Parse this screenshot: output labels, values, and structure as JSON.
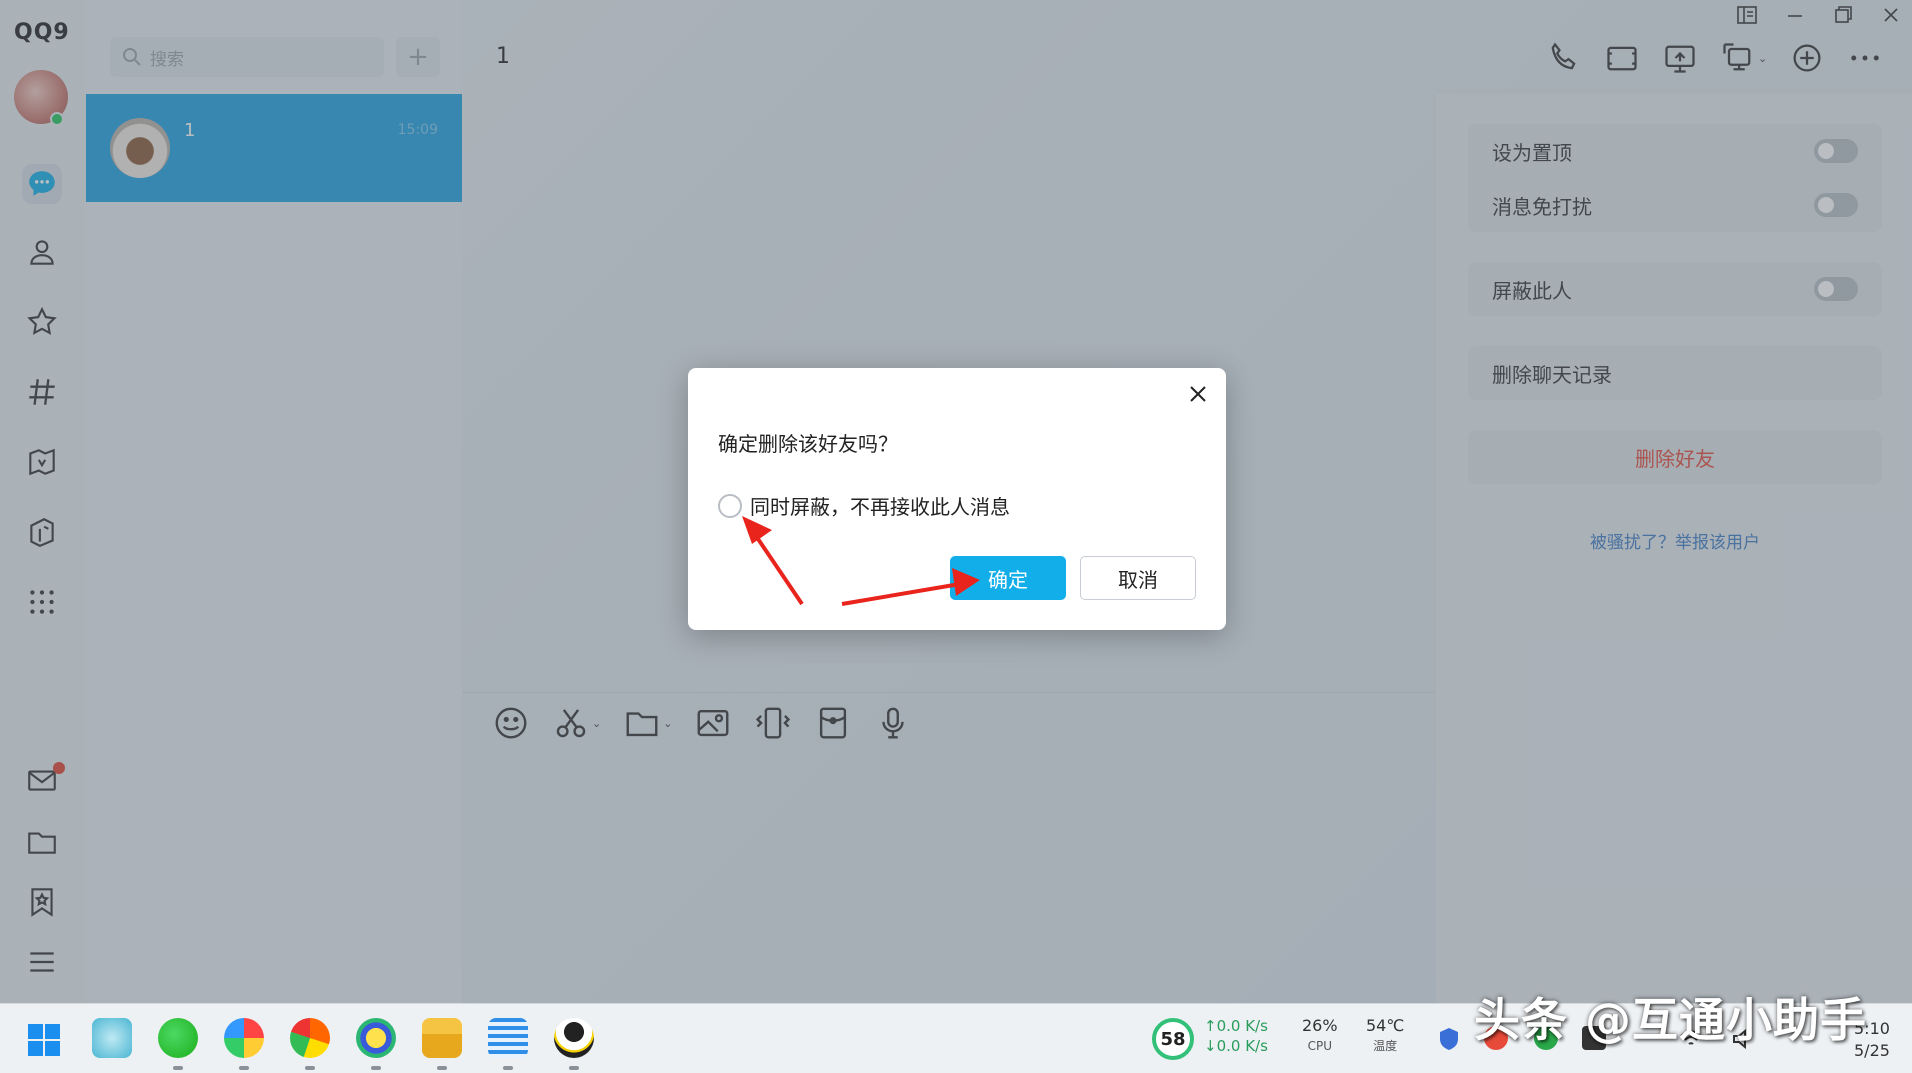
{
  "app": {
    "logo": "QQ9"
  },
  "search": {
    "placeholder": "搜索",
    "add_label": "+"
  },
  "chat_list": [
    {
      "name": "1",
      "time": "15:09"
    }
  ],
  "main": {
    "title": "1"
  },
  "settings": {
    "pin_label": "设为置顶",
    "mute_label": "消息免打扰",
    "block_label": "屏蔽此人",
    "clear_history_label": "删除聊天记录",
    "delete_friend_label": "删除好友",
    "report_label": "被骚扰了？举报该用户",
    "pin_on": false,
    "mute_on": false,
    "block_on": false
  },
  "dialog": {
    "question": "确定删除该好友吗？",
    "option_label": "同时屏蔽，不再接收此人消息",
    "option_checked": false,
    "ok_label": "确定",
    "cancel_label": "取消"
  },
  "taskbar": {
    "score": "58",
    "net_up": "↑0.0 K/s",
    "net_down": "↓0.0 K/s",
    "cpu_value": "26%",
    "cpu_label": "CPU",
    "temp_value": "54℃",
    "temp_label": "温度",
    "time": "5:10",
    "date": "5/25"
  },
  "watermark": "头条 @互通小助手",
  "colors": {
    "accent": "#12aee9",
    "selected": "#1ea0e0",
    "danger": "#e64a3b",
    "link": "#3d7cc4"
  }
}
